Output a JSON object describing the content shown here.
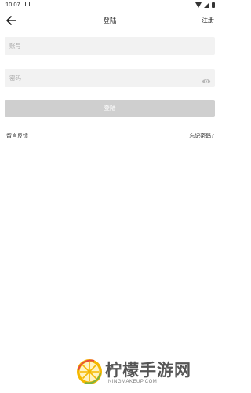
{
  "status_bar": {
    "time": "10:07"
  },
  "header": {
    "back_icon": "arrow-left-icon",
    "title": "登陆",
    "register_label": "注册"
  },
  "form": {
    "account_placeholder": "账号",
    "account_value": "",
    "password_placeholder": "密码",
    "password_value": "",
    "password_toggle_icon": "eye-icon",
    "login_label": "登陆"
  },
  "links": {
    "feedback": "留言反馈",
    "forgot_password": "忘记密码?"
  },
  "watermark": {
    "brand": "柠檬手游网",
    "url": "NINGMAKEUP.COM"
  },
  "colors": {
    "field_bg": "#f2f2f2",
    "button_disabled_bg": "#cfcfcf"
  }
}
